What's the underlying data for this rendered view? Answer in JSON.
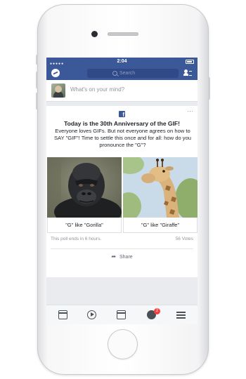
{
  "status_bar": {
    "time": "2:04"
  },
  "nav": {
    "search_placeholder": "Search"
  },
  "composer": {
    "prompt": "What's on your mind?"
  },
  "post": {
    "title": "Today is the 30th Anniversary of the GIF!",
    "description": "Everyone loves GIFs. But not everyone agrees on how to SAY \"GIF\"! Time to settle this once and for all: how do you pronounce the \"G\"?",
    "more_glyph": "···",
    "fb_logo": "f",
    "options": [
      {
        "label": "\"G\" like \"Gorilla\"",
        "image": "gorilla-photo"
      },
      {
        "label": "\"G\" like \"Giraffe\"",
        "image": "giraffe-photo"
      }
    ],
    "poll_status": "This poll ends in 6 hours.",
    "votes": "56 Votes",
    "share_label": "Share"
  },
  "tab_bar": {
    "items": [
      "news-feed",
      "video",
      "marketplace",
      "notifications",
      "menu"
    ],
    "notifications_badge": "2"
  },
  "colors": {
    "brand": "#3b5998",
    "badge": "#fa3e3e",
    "background": "#e9ebee"
  }
}
